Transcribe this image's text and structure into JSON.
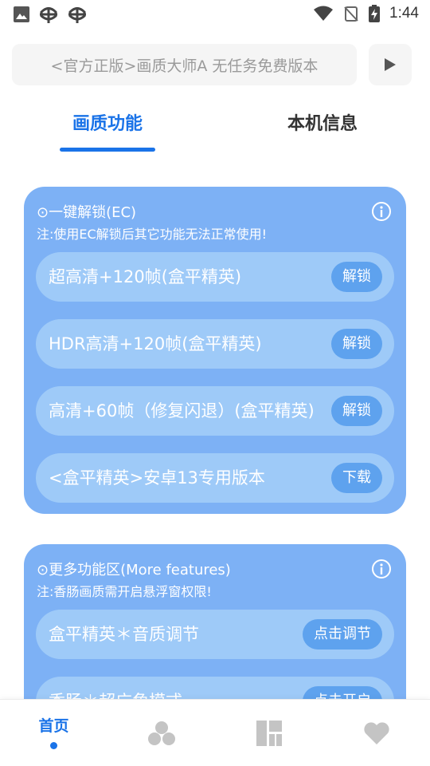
{
  "status_bar": {
    "time": "1:44",
    "icons": [
      "image-icon",
      "bug-icon",
      "bug-icon",
      "wifi-icon",
      "no-signal-icon",
      "battery-charging-icon"
    ]
  },
  "search": {
    "text": "<官方正版>画质大师A 无任务免费版本"
  },
  "tabs": [
    {
      "label": "画质功能",
      "active": true
    },
    {
      "label": "本机信息",
      "active": false
    }
  ],
  "unlock_card": {
    "title": "⊙一键解锁(EC)",
    "note": "注:使用EC解锁后其它功能无法正常使用!",
    "rows": [
      {
        "label": "超高清+120帧(盒平精英)",
        "button": "解锁"
      },
      {
        "label": "HDR高清+120帧(盒平精英)",
        "button": "解锁"
      },
      {
        "label": "高清+60帧（修复闪退）(盒平精英)",
        "button": "解锁"
      },
      {
        "label": "<盒平精英>安卓13专用版本",
        "button": "下载"
      }
    ]
  },
  "more_card": {
    "title": "⊙更多功能区(More features)",
    "note": "注:香肠画质需开启悬浮窗权限!",
    "rows": [
      {
        "label": "盒平精英＊音质调节",
        "button": "点击调节"
      },
      {
        "label": "香肠＊超广角模式",
        "button": "点击开启"
      }
    ]
  },
  "bottom_nav": {
    "home_label": "首页",
    "items": [
      "home",
      "circles-icon",
      "dashboard-icon",
      "heart-icon"
    ]
  },
  "colors": {
    "accent": "#1a73e8",
    "card": "#7db1f5",
    "row": "#9ecaf8",
    "row_button": "#5ea2ee"
  }
}
